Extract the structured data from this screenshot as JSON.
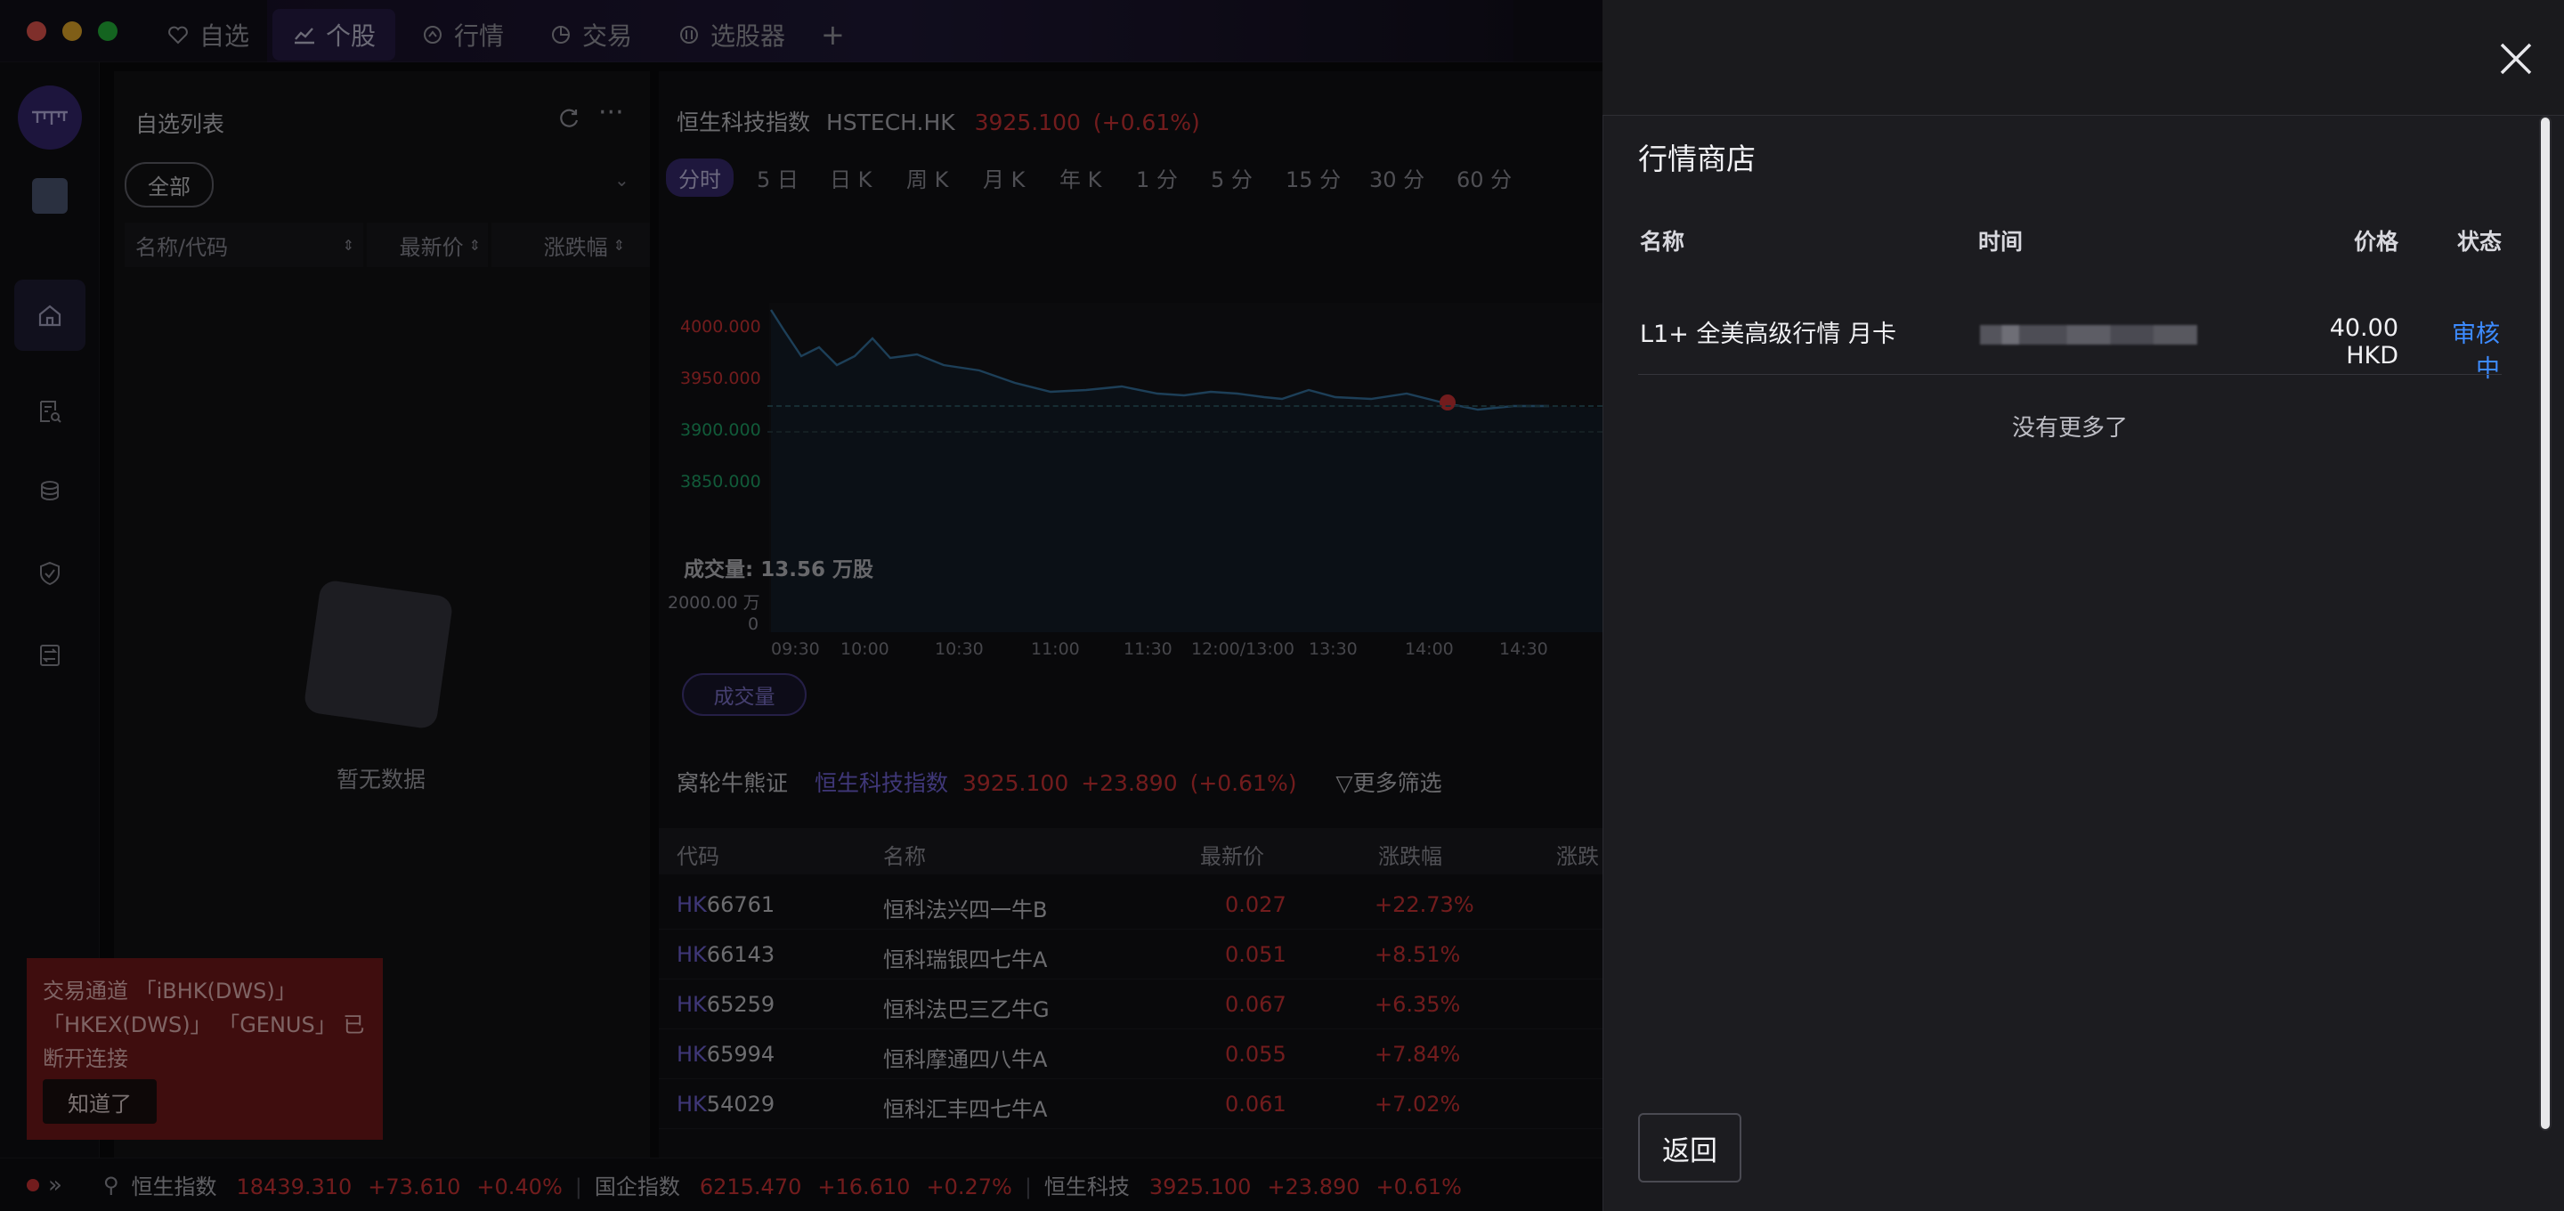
{
  "window": {
    "tabs": [
      {
        "label": "自选",
        "icon": "heart-icon"
      },
      {
        "label": "个股",
        "icon": "chart-line-icon"
      },
      {
        "label": "行情",
        "icon": "quote-icon"
      },
      {
        "label": "交易",
        "icon": "pie-icon"
      },
      {
        "label": "选股器",
        "icon": "stock-picker-icon"
      }
    ],
    "active_tab": "个股",
    "add_tab_label": "+"
  },
  "watchlist": {
    "title": "自选列表",
    "filter_pill": "全部",
    "columns": [
      "名称/代码",
      "最新价",
      "涨跌幅"
    ],
    "empty_text": "暂无数据"
  },
  "chart": {
    "name": "恒生科技指数",
    "code": "HSTECH.HK",
    "price": "3925.100",
    "change_pct": "(+0.61%)",
    "periods": [
      "分时",
      "5 日",
      "日 K",
      "周 K",
      "月 K",
      "年 K",
      "1 分",
      "5 分",
      "15 分",
      "30 分",
      "60 分"
    ],
    "active_period": "分时",
    "y_labels": [
      "4000.000",
      "3950.000",
      "3900.000",
      "3850.000"
    ],
    "volume_label": "成交量: 13.56 万股",
    "volume_axis": [
      "2000.00 万",
      "0"
    ],
    "x_labels": [
      "09:30",
      "10:00",
      "10:30",
      "11:00",
      "11:30",
      "12:00/13:00",
      "13:30",
      "14:00",
      "14:30"
    ],
    "volume_button": "成交量"
  },
  "warrants": {
    "title": "窝轮牛熊证",
    "index_name": "恒生科技指数",
    "index_price": "3925.100",
    "index_change": "+23.890",
    "index_pct": "(+0.61%)",
    "filter_label": "更多筛选",
    "columns": [
      "代码",
      "名称",
      "最新价",
      "涨跌幅",
      "涨跌"
    ],
    "rows": [
      {
        "code_prefix": "HK",
        "code": "66761",
        "name": "恒科法兴四一牛B",
        "price": "0.027",
        "pct": "+22.73%"
      },
      {
        "code_prefix": "HK",
        "code": "66143",
        "name": "恒科瑞银四七牛A",
        "price": "0.051",
        "pct": "+8.51%"
      },
      {
        "code_prefix": "HK",
        "code": "65259",
        "name": "恒科法巴三乙牛G",
        "price": "0.067",
        "pct": "+6.35%"
      },
      {
        "code_prefix": "HK",
        "code": "65994",
        "name": "恒科摩通四八牛A",
        "price": "0.055",
        "pct": "+7.84%"
      },
      {
        "code_prefix": "HK",
        "code": "54029",
        "name": "恒科汇丰四七牛A",
        "price": "0.061",
        "pct": "+7.02%"
      }
    ]
  },
  "alert": {
    "message": "交易通道 「iBHK(DWS)」 「HKEX(DWS)」 「GENUS」 已断开连接",
    "button": "知道了"
  },
  "ticker": [
    {
      "name": "恒生指数",
      "price": "18439.310",
      "change": "+73.610",
      "pct": "+0.40%"
    },
    {
      "name": "国企指数",
      "price": "6215.470",
      "change": "+16.610",
      "pct": "+0.27%"
    },
    {
      "name": "恒生科技",
      "price": "3925.100",
      "change": "+23.890",
      "pct": "+0.61%"
    }
  ],
  "store": {
    "title": "行情商店",
    "columns": {
      "name": "名称",
      "time": "时间",
      "price": "价格",
      "status": "状态"
    },
    "items": [
      {
        "name": "L1+ 全美高级行情 月卡",
        "price": "40.00 HKD",
        "status": "审核中"
      }
    ],
    "no_more": "没有更多了",
    "back_button": "返回"
  },
  "colors": {
    "accent": "#3d8bff",
    "up": "#e5383b",
    "down": "#22b573",
    "brand": "#3c2f7a"
  }
}
